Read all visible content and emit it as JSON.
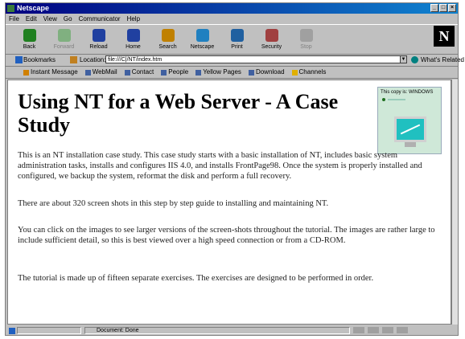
{
  "window": {
    "title": "Netscape"
  },
  "menu": [
    "File",
    "Edit",
    "View",
    "Go",
    "Communicator",
    "Help"
  ],
  "toolbar": {
    "buttons": [
      {
        "label": "Back",
        "icon": "back-arrow-icon",
        "color": "#208020"
      },
      {
        "label": "Forward",
        "icon": "forward-arrow-icon",
        "color": "#80b080",
        "disabled": true
      },
      {
        "label": "Reload",
        "icon": "reload-icon",
        "color": "#2040a0"
      },
      {
        "label": "Home",
        "icon": "home-icon",
        "color": "#2040a0"
      },
      {
        "label": "Search",
        "icon": "search-icon",
        "color": "#c08000"
      },
      {
        "label": "Netscape",
        "icon": "netscape-icon",
        "color": "#2080c0"
      },
      {
        "label": "Print",
        "icon": "print-icon",
        "color": "#2060a0"
      },
      {
        "label": "Security",
        "icon": "security-icon",
        "color": "#a04040"
      },
      {
        "label": "Stop",
        "icon": "stop-icon",
        "color": "#a0a0a0",
        "disabled": true
      }
    ],
    "logo": "N"
  },
  "location": {
    "bookmarks_label": "Bookmarks",
    "location_label": "Location:",
    "url": "file:///C|/NT/index.htm",
    "related_label": "What's Related"
  },
  "personal_toolbar": [
    "Instant Message",
    "WebMail",
    "Contact",
    "People",
    "Yellow Pages",
    "Download",
    "Channels"
  ],
  "page": {
    "heading": "Using NT for a Web Server - A Case Study",
    "thumbnail_caption": "This copy is: WINDOWS",
    "paragraphs": [
      "This is an NT installation case study. This case study starts with a basic installation of NT, includes basic system administration tasks, installs and configures IIS 4.0, and installs FrontPage98.  Once the system is properly installed and configured, we backup the system, reformat the disk and perform a full recovery.",
      "There are about 320 screen shots in this step by step guide to installing and maintaining NT.",
      "You can click on the images to see larger versions of the screen-shots throughout the tutorial. The images are rather large to include sufficient detail, so this is best viewed over a high speed connection or from a CD-ROM.",
      "The tutorial is made up of fifteen separate exercises.  The exercises are designed to be performed in order."
    ]
  },
  "status": {
    "text": "Document: Done"
  }
}
